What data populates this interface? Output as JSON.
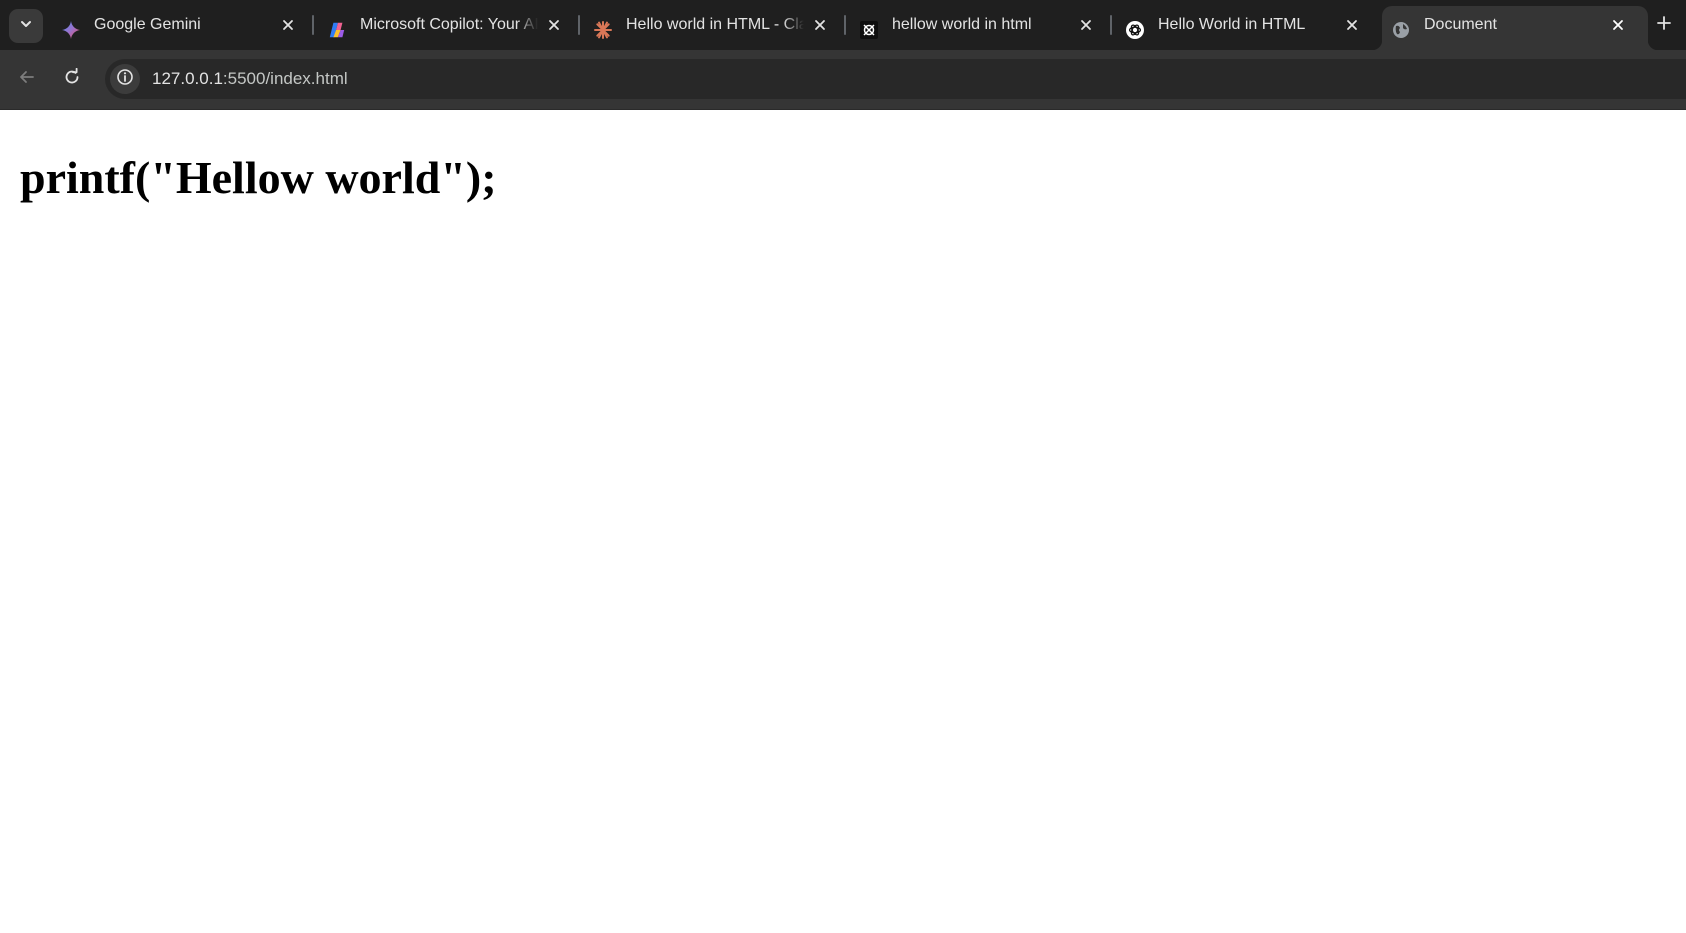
{
  "browser": {
    "tabs": [
      {
        "title": "Google Gemini",
        "favicon": "gemini-icon",
        "active": false
      },
      {
        "title": "Microsoft Copilot: Your AI companion",
        "favicon": "copilot-icon",
        "active": false
      },
      {
        "title": "Hello world in HTML - Claude",
        "favicon": "claude-icon",
        "active": false
      },
      {
        "title": "hellow world in html",
        "favicon": "grok-icon",
        "active": false
      },
      {
        "title": "Hello World in HTML",
        "favicon": "chatgpt-icon",
        "active": false
      },
      {
        "title": "Document",
        "favicon": "globe-icon",
        "active": true
      }
    ],
    "address": {
      "host": "127.0.0.1",
      "path": ":5500/index.html"
    }
  },
  "page": {
    "heading": "printf(\"Hellow world\");"
  },
  "colors": {
    "tabstrip": "#1f1f1f",
    "toolbar": "#353535",
    "omnibox": "#282828",
    "tab_text": "#e3e3e3",
    "page_background": "#ffffff",
    "heading": "#000000"
  }
}
